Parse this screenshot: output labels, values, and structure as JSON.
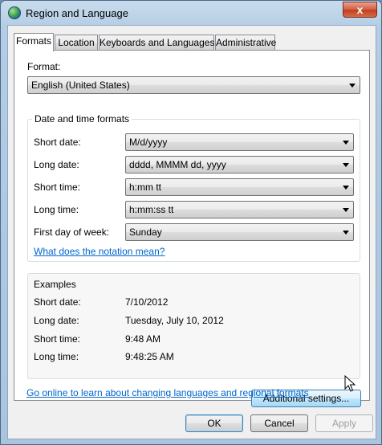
{
  "window": {
    "title": "Region and Language",
    "close_label": "x"
  },
  "tabs": [
    {
      "label": "Formats",
      "active": true
    },
    {
      "label": "Location",
      "active": false
    },
    {
      "label": "Keyboards and Languages",
      "active": false
    },
    {
      "label": "Administrative",
      "active": false
    }
  ],
  "format": {
    "label": "Format:",
    "value": "English (United States)"
  },
  "date_time_formats": {
    "title": "Date and time formats",
    "rows": [
      {
        "label": "Short date:",
        "value": "M/d/yyyy"
      },
      {
        "label": "Long date:",
        "value": "dddd, MMMM dd, yyyy"
      },
      {
        "label": "Short time:",
        "value": "h:mm tt"
      },
      {
        "label": "Long time:",
        "value": "h:mm:ss tt"
      },
      {
        "label": "First day of week:",
        "value": "Sunday"
      }
    ],
    "notation_link": "What does the notation mean?"
  },
  "examples": {
    "title": "Examples",
    "rows": [
      {
        "label": "Short date:",
        "value": "7/10/2012"
      },
      {
        "label": "Long date:",
        "value": "Tuesday, July 10, 2012"
      },
      {
        "label": "Short time:",
        "value": "9:48 AM"
      },
      {
        "label": "Long time:",
        "value": "9:48:25 AM"
      }
    ]
  },
  "additional_settings_label": "Additional settings...",
  "online_link": "Go online to learn about changing languages and regional formats",
  "footer": {
    "ok_label": "OK",
    "cancel_label": "Cancel",
    "apply_label": "Apply"
  }
}
